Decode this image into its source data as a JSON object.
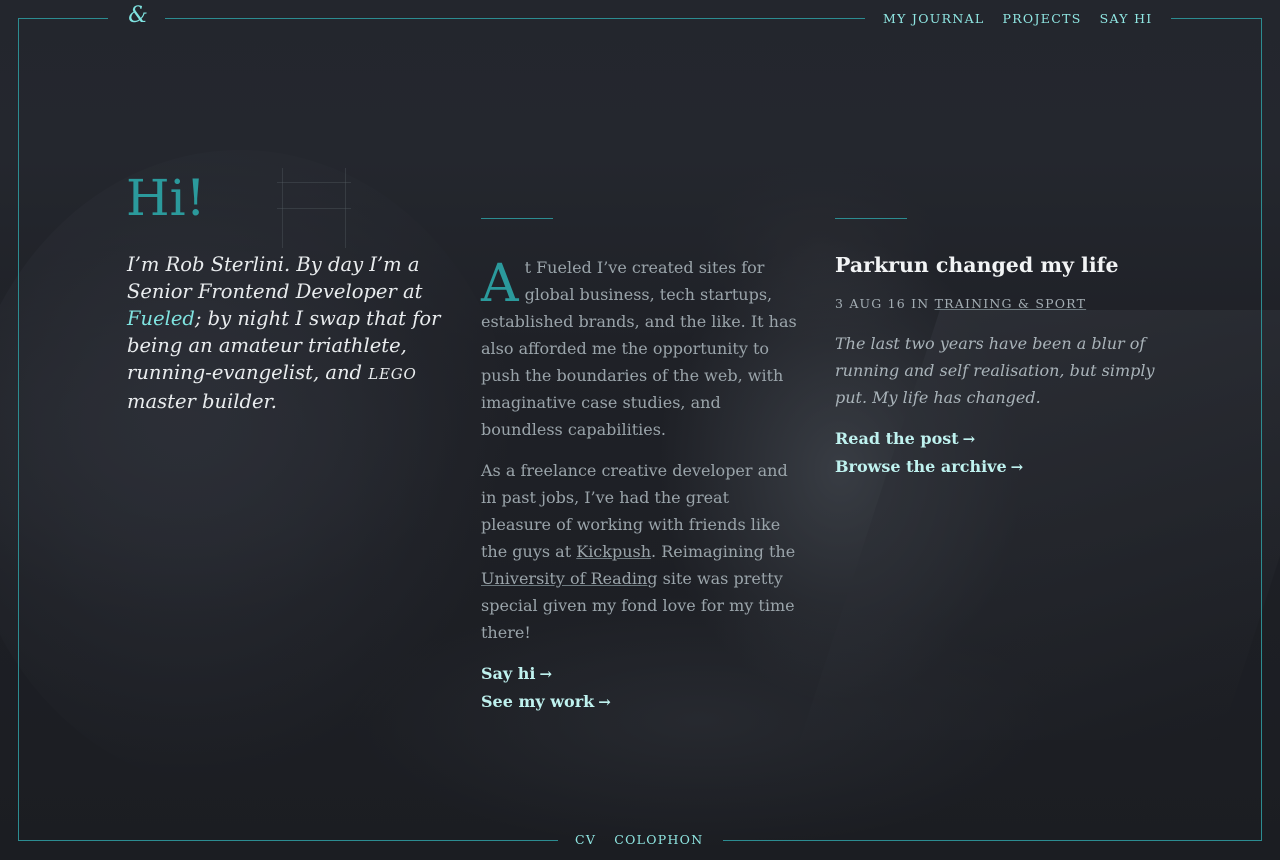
{
  "header": {
    "logo": "&",
    "nav": [
      "MY JOURNAL",
      "PROJECTS",
      "SAY HI"
    ]
  },
  "footer": {
    "nav": [
      "CV",
      "COLOPHON"
    ]
  },
  "intro": {
    "heading": "Hi!",
    "text_1": "I’m Rob Sterlini. By day I’m a Senior Frontend Developer at ",
    "link": "Fueled",
    "text_2": "; by night I swap that for being an amateur triathlete, running-evangelist, and ",
    "smallcaps": "LEGO",
    "text_3": " master builder."
  },
  "about": {
    "dropcap": "A",
    "para1": "t Fueled I’ve created sites for global business, tech startups, established brands, and the like. It has also afforded me the opportunity to push the boundaries of the web, with imaginative case studies, and boundless capabilities.",
    "para2_a": "As a freelance creative developer and in past jobs, I’ve had the great pleasure of working with friends like the guys at ",
    "link_kickpush": "Kickpush",
    "para2_b": ". Reimagining the ",
    "link_reading": "University of Reading",
    "para2_c": " site was pretty special given my fond love for my time there!",
    "cta_1": "Say hi",
    "cta_2": "See my work",
    "arrow": "→"
  },
  "post": {
    "title": "Parkrun changed my life",
    "date": "3 AUG 16",
    "in": " IN ",
    "category": "TRAINING & SPORT",
    "excerpt": "The last two years have been a blur of running and self realisation, but simply put. My life has changed.",
    "cta_1": "Read the post",
    "cta_2": "Browse the archive",
    "arrow": "→"
  },
  "colors": {
    "accent": "#2b9a9c",
    "link": "#7fe3e0",
    "frame": "#2c8c91",
    "background": "#1c1e24"
  }
}
